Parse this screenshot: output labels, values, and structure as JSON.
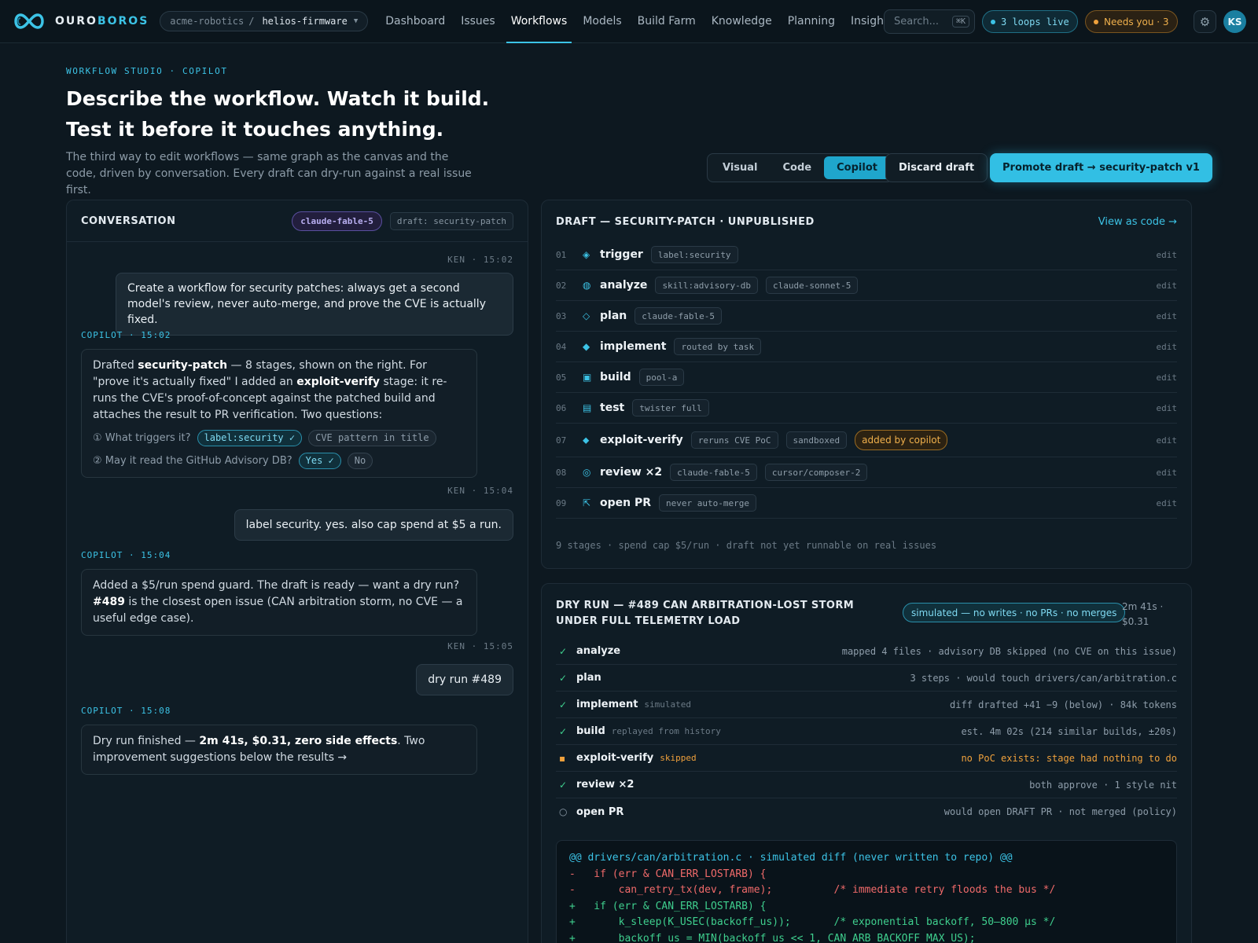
{
  "nav": {
    "brand_a": "OURO",
    "brand_b": "BOROS",
    "org": "acme-robotics",
    "separator": "/",
    "repo": "helios-firmware",
    "links": [
      "Dashboard",
      "Issues",
      "Workflows",
      "Models",
      "Build Farm",
      "Knowledge",
      "Planning",
      "Insights"
    ],
    "active_link": "Workflows",
    "search_placeholder": "Search...",
    "search_shortcut": "⌘K",
    "loops_live": "3 loops live",
    "needs_you": "Needs you · 3",
    "avatar": "KS"
  },
  "header": {
    "eyebrow": "WORKFLOW STUDIO · COPILOT",
    "title_line1": "Describe the workflow. Watch it build.",
    "title_line2": "Test it before it touches anything.",
    "subtitle": "The third way to edit workflows — same graph as the canvas and the code, driven by conversation. Every draft can dry-run against a real issue first.",
    "modes": [
      "Visual",
      "Code",
      "Copilot"
    ],
    "active_mode": "Copilot",
    "discard": "Discard draft",
    "promote": "Promote draft → security-patch v1"
  },
  "conversation": {
    "title": "CONVERSATION",
    "model": "claude-fable-5",
    "draft": "draft: security-patch",
    "messages": [
      {
        "meta": "KEN · 15:02",
        "text": "Create a workflow for security patches: always get a second model's review, never auto-merge, and prove the CVE is actually fixed."
      },
      {
        "meta": "COPILOT · 15:02",
        "p1": "Drafted ",
        "b1": "security-patch",
        "p2": " — 8 stages, shown on the right. For \"prove it's actually fixed\" I added an ",
        "b2": "exploit-verify",
        "p3": " stage: it re-runs the CVE's proof-of-concept against the patched build and attaches the result to PR verification. Two questions:",
        "q1": "① What triggers it?",
        "q1_opt1": "label:security ✓",
        "q1_opt2": "CVE pattern in title",
        "q2": "② May it read the GitHub Advisory DB?",
        "q2_opt1": "Yes ✓",
        "q2_opt2": "No"
      },
      {
        "meta": "KEN · 15:04",
        "text": "label security. yes. also cap spend at $5 a run."
      },
      {
        "meta": "COPILOT · 15:04",
        "p1": "Added a $5/run spend guard. The draft is ready — want a dry run? ",
        "b1": "#489",
        "p2": " is the closest open issue (CAN arbitration storm, no CVE — a useful edge case)."
      },
      {
        "meta": "KEN · 15:05",
        "text": "dry run #489"
      },
      {
        "meta": "COPILOT · 15:08",
        "p1": "Dry run finished — ",
        "b1": "2m 41s, $0.31, zero side effects",
        "p2": ". Two improvement suggestions below the results →"
      }
    ]
  },
  "draft": {
    "title": "DRAFT — SECURITY-PATCH · UNPUBLISHED",
    "view_code": "View as code →",
    "edit_label": "edit",
    "stages": [
      {
        "num": "01",
        "icon": "◈",
        "name": "trigger",
        "tags": [
          "label:security"
        ]
      },
      {
        "num": "02",
        "icon": "◍",
        "name": "analyze",
        "tags": [
          "skill:advisory-db",
          "claude-sonnet-5"
        ]
      },
      {
        "num": "03",
        "icon": "◇",
        "name": "plan",
        "tags": [
          "claude-fable-5"
        ]
      },
      {
        "num": "04",
        "icon": "◆",
        "name": "implement",
        "tags": [
          "routed by task"
        ]
      },
      {
        "num": "05",
        "icon": "▣",
        "name": "build",
        "tags": [
          "pool-a"
        ]
      },
      {
        "num": "06",
        "icon": "▤",
        "name": "test",
        "tags": [
          "twister full"
        ]
      },
      {
        "num": "07",
        "icon": "⬥",
        "name": "exploit-verify",
        "tags": [
          "reruns CVE PoC",
          "sandboxed"
        ],
        "badge": "added by copilot"
      },
      {
        "num": "08",
        "icon": "◎",
        "name": "review ×2",
        "tags": [
          "claude-fable-5",
          "cursor/composer-2"
        ]
      },
      {
        "num": "09",
        "icon": "⇱",
        "name": "open PR",
        "tags": [
          "never auto-merge"
        ]
      }
    ],
    "footer": "9 stages · spend cap $5/run · draft not yet runnable on real issues"
  },
  "dryrun": {
    "title": "DRY RUN — #489 CAN ARBITRATION-LOST STORM UNDER FULL TELEMETRY LOAD",
    "sim": "simulated — no writes · no PRs · no merges",
    "time": "2m 41s ·",
    "cost": "$0.31",
    "rows": [
      {
        "state": "ok",
        "icon": "✓",
        "name": "analyze",
        "note": "",
        "detail": "mapped 4 files · advisory DB skipped (no CVE on this issue)"
      },
      {
        "state": "ok",
        "icon": "✓",
        "name": "plan",
        "note": "",
        "detail": "3 steps · would touch drivers/can/arbitration.c"
      },
      {
        "state": "ok",
        "icon": "✓",
        "name": "implement",
        "note": "simulated",
        "detail": "diff drafted +41 −9 (below) · 84k tokens"
      },
      {
        "state": "ok",
        "icon": "✓",
        "name": "build",
        "note": "replayed from history",
        "detail": "est. 4m 02s (214 similar builds, ±20s)"
      },
      {
        "state": "skip",
        "icon": "▪",
        "name": "exploit-verify",
        "note": "skipped",
        "detail": "no PoC exists: stage had nothing to do"
      },
      {
        "state": "ok",
        "icon": "✓",
        "name": "review ×2",
        "note": "",
        "detail": "both approve · 1 style nit"
      },
      {
        "state": "pend",
        "icon": "○",
        "name": "open PR",
        "note": "",
        "detail": "would open DRAFT PR · not merged (policy)"
      }
    ],
    "diff": {
      "header": "@@ drivers/can/arbitration.c · simulated diff (never written to repo) @@",
      "lines": [
        {
          "kind": "minus",
          "code": "-   if (err & CAN_ERR_LOSTARB) {",
          "comment": ""
        },
        {
          "kind": "minus",
          "code": "-       can_retry_tx(dev, frame);          ",
          "comment": "/* immediate retry floods the bus */"
        },
        {
          "kind": "plus",
          "code": "+   if (err & CAN_ERR_LOSTARB) {",
          "comment": ""
        },
        {
          "kind": "plus",
          "code": "+       k_sleep(K_USEC(backoff_us));       ",
          "comment": "/* exponential backoff, 50–800 µs */"
        },
        {
          "kind": "plus",
          "code": "+       backoff_us = MIN(backoff_us << 1, CAN_ARB_BACKOFF_MAX_US);",
          "comment": ""
        }
      ]
    }
  }
}
